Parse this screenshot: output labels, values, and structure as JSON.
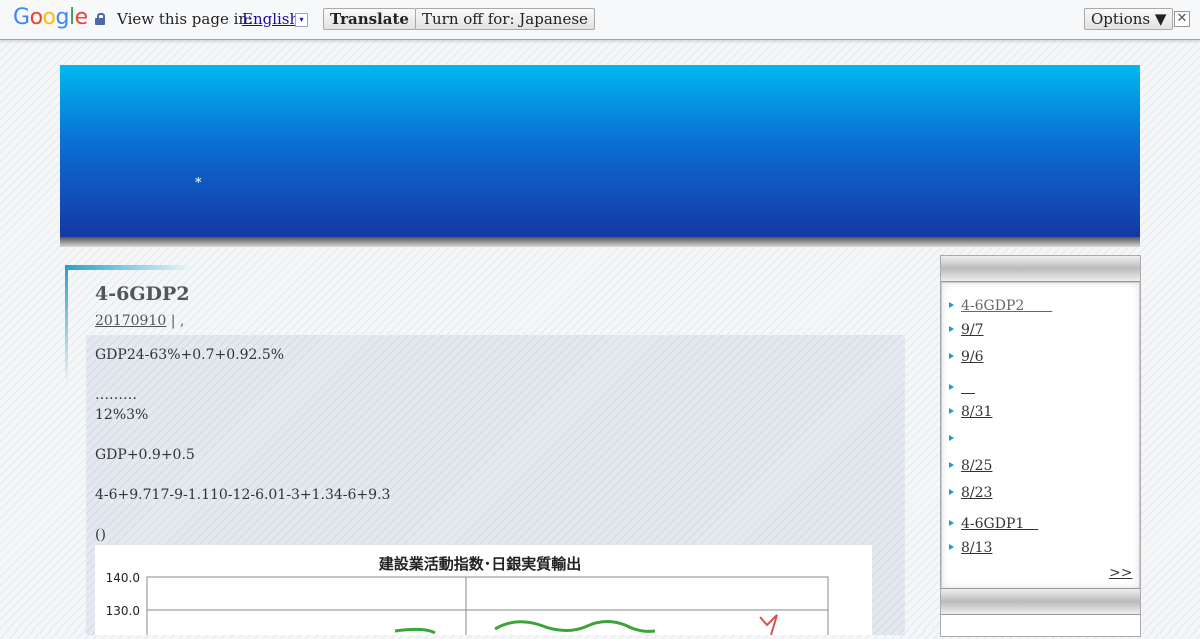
{
  "translate_bar": {
    "logo": "Google",
    "view_label": "View this page in:",
    "language": "English",
    "language_arrow": "▾",
    "translate_button": "Translate",
    "turn_off_button": "Turn off for: Japanese",
    "options_button": "Options ▼",
    "close": "✕"
  },
  "banner": {
    "star": "*"
  },
  "post": {
    "title": "4-6GDP2",
    "date": "20170910",
    "meta_sep": " | ,",
    "lines": [
      "GDP24-63%+0.7+0.92.5%",
      "………",
      "12%3%",
      "GDP+0.9+0.5",
      "4-6+9.717-9-1.110-12-6.01-3+1.34-6+9.3",
      "()"
    ]
  },
  "chart_data": {
    "type": "line",
    "title": "建設業活動指数･日銀実質輸出",
    "yticks": [
      "140.0",
      "130.0"
    ],
    "ylim": [
      120,
      140
    ],
    "series": [
      {
        "color": "#3aa53a"
      },
      {
        "color": "#d9534f"
      }
    ]
  },
  "sidebar": {
    "items": [
      {
        "label": "4-6GDP2　　",
        "visited": true
      },
      {
        "label": "9/7"
      },
      {
        "label": "9/6"
      },
      {
        "label": "　"
      },
      {
        "label": "8/31"
      },
      {
        "label": ""
      },
      {
        "label": "8/25"
      },
      {
        "label": "8/23"
      },
      {
        "label": "4-6GDP1　"
      },
      {
        "label": "8/13"
      }
    ],
    "more": ">>"
  }
}
